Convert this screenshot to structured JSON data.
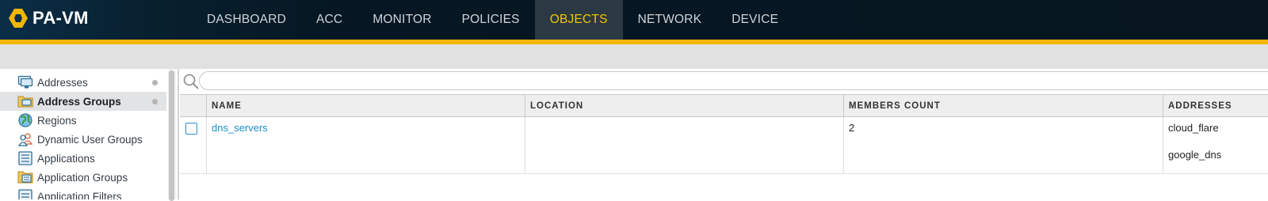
{
  "app": {
    "name": "PA-VM"
  },
  "colors": {
    "accent": "#f2b600",
    "active_tab_text": "#f2c400",
    "link": "#1a8fcb"
  },
  "nav": {
    "tabs": [
      {
        "label": "DASHBOARD",
        "active": false
      },
      {
        "label": "ACC",
        "active": false
      },
      {
        "label": "MONITOR",
        "active": false
      },
      {
        "label": "POLICIES",
        "active": false
      },
      {
        "label": "OBJECTS",
        "active": true
      },
      {
        "label": "NETWORK",
        "active": false
      },
      {
        "label": "DEVICE",
        "active": false
      }
    ]
  },
  "sidebar": {
    "items": [
      {
        "label": "Addresses",
        "icon": "address-icon",
        "active": false
      },
      {
        "label": "Address Groups",
        "icon": "address-group-icon",
        "active": true
      },
      {
        "label": "Regions",
        "icon": "globe-icon",
        "active": false
      },
      {
        "label": "Dynamic User Groups",
        "icon": "users-icon",
        "active": false
      },
      {
        "label": "Applications",
        "icon": "application-icon",
        "active": false
      },
      {
        "label": "Application Groups",
        "icon": "application-group-icon",
        "active": false
      },
      {
        "label": "Application Filters",
        "icon": "application-filter-icon",
        "active": false
      }
    ]
  },
  "search": {
    "placeholder": "",
    "value": ""
  },
  "table": {
    "columns": [
      "NAME",
      "LOCATION",
      "MEMBERS COUNT",
      "ADDRESSES"
    ],
    "rows": [
      {
        "name": "dns_servers",
        "location": "",
        "members_count": "2",
        "addresses": [
          "cloud_flare",
          "google_dns"
        ]
      }
    ]
  }
}
